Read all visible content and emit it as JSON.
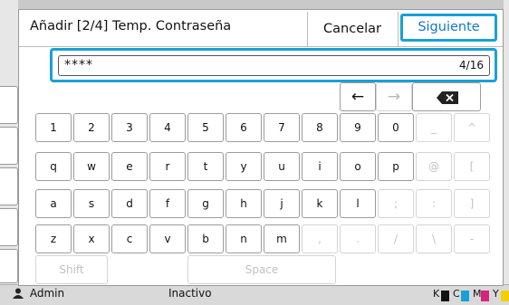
{
  "background": {
    "status_user": "Admin",
    "status_mid": "Inactivo",
    "ink_labels": [
      "K",
      "C",
      "M",
      "Y"
    ]
  },
  "colors": {
    "accent": "#1aa0d8",
    "accent_text": "#1278c8"
  },
  "dialog": {
    "title": "Añadir [2/4] Temp. Contraseña",
    "cancel_label": "Cancelar",
    "next_label": "Siguiente",
    "input": {
      "value": "****",
      "count": "4/16"
    },
    "nav": {
      "left_arrow": "←",
      "right_arrow": "→",
      "backspace_icon": "backspace-icon"
    },
    "keyboard": {
      "rows": [
        [
          "1",
          "2",
          "3",
          "4",
          "5",
          "6",
          "7",
          "8",
          "9",
          "0",
          "_",
          "^"
        ],
        [
          "q",
          "w",
          "e",
          "r",
          "t",
          "y",
          "u",
          "i",
          "o",
          "p",
          "@",
          "["
        ],
        [
          "a",
          "s",
          "d",
          "f",
          "g",
          "h",
          "j",
          "k",
          "l",
          ";",
          ":",
          "]"
        ],
        [
          "z",
          "x",
          "c",
          "v",
          "b",
          "n",
          "m",
          ",",
          ".",
          "/",
          "\\",
          "-"
        ]
      ],
      "shift_label": "Shift",
      "space_label": "Space"
    }
  }
}
